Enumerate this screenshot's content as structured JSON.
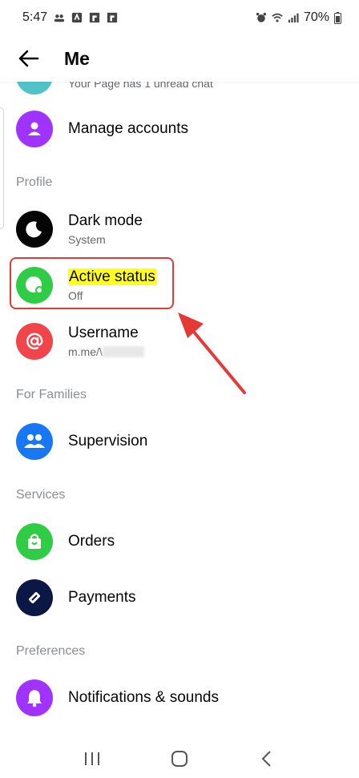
{
  "status_bar": {
    "time": "5:47",
    "battery": "70%"
  },
  "header": {
    "title": "Me"
  },
  "items": {
    "page_notice": {
      "subtitle": "Your Page has 1 unread chat"
    },
    "manage_accounts": {
      "title": "Manage accounts"
    },
    "dark_mode": {
      "title": "Dark mode",
      "subtitle": "System"
    },
    "active_status": {
      "title": "Active status",
      "subtitle": "Off"
    },
    "username": {
      "title": "Username",
      "subtitle": "m.me/\\"
    },
    "supervision": {
      "title": "Supervision"
    },
    "orders": {
      "title": "Orders"
    },
    "payments": {
      "title": "Payments"
    },
    "notifications": {
      "title": "Notifications & sounds"
    }
  },
  "sections": {
    "profile": "Profile",
    "families": "For Families",
    "services": "Services",
    "preferences": "Preferences"
  },
  "colors": {
    "teal": "#4fc3c8",
    "purple": "#a033ff",
    "black": "#050505",
    "green": "#31cc46",
    "red": "#f0464b",
    "blue": "#1877f2",
    "navy": "#0b1845",
    "annotation": "#e53935",
    "highlight": "#ffff1a"
  },
  "icons": [
    "back-arrow-icon",
    "person-icon",
    "moon-icon",
    "active-dot-icon",
    "at-icon",
    "people-icon",
    "bag-icon",
    "tag-icon",
    "bell-icon"
  ]
}
